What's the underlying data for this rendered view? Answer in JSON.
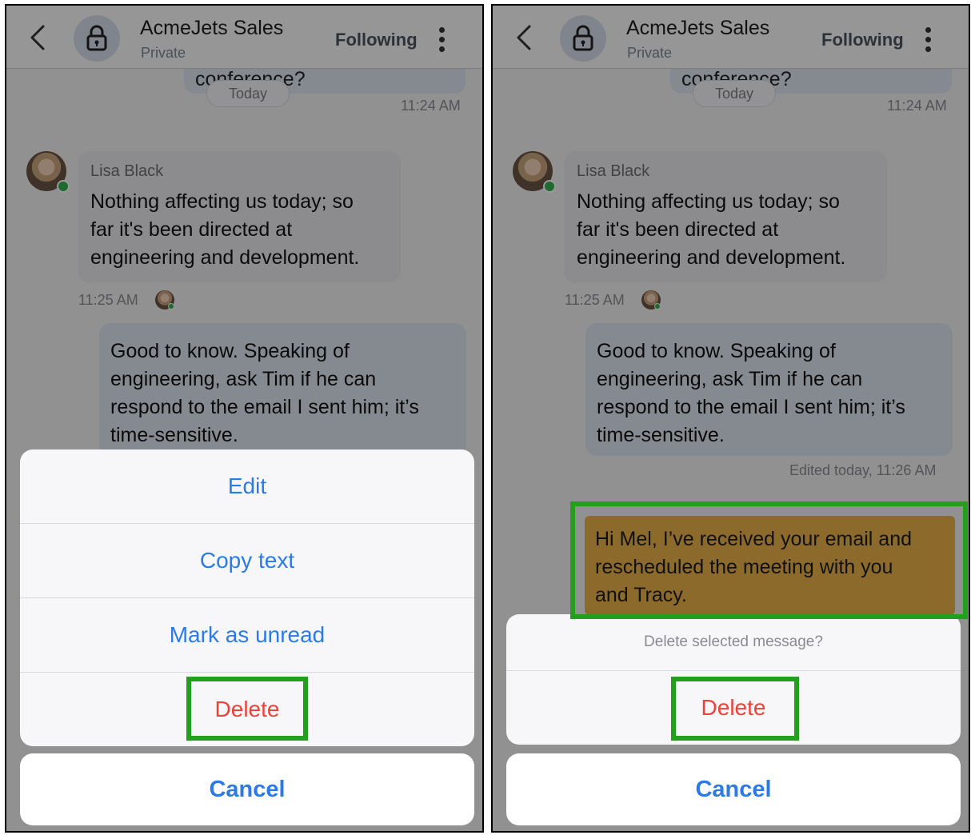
{
  "channel": {
    "title": "AcmeJets Sales",
    "subtitle": "Private",
    "following_label": "Following"
  },
  "previous_message": {
    "partial_text": "conference?"
  },
  "date_chip": "Today",
  "times": {
    "prev_sent": "11:24 AM",
    "lisa_sent": "11:25 AM",
    "edited": "Edited today, 11:26 AM"
  },
  "messages": {
    "lisa": {
      "sender": "Lisa Black",
      "lines": [
        "Nothing affecting us today; so",
        "far it's been directed at",
        "engineering and development."
      ]
    },
    "own": {
      "lines": [
        "Good to know. Speaking of",
        "engineering, ask Tim if he can",
        "respond to the email I sent him; it’s",
        "time-sensitive."
      ]
    },
    "selected": {
      "lines": [
        "Hi Mel, I’ve received your email and",
        "rescheduled the meeting with you",
        "and Tracy."
      ]
    }
  },
  "action_sheet_left": {
    "items": [
      "Edit",
      "Copy text",
      "Mark as unread",
      "Delete"
    ],
    "cancel": "Cancel"
  },
  "action_sheet_right": {
    "prompt": "Delete selected message?",
    "delete": "Delete",
    "cancel": "Cancel"
  },
  "colors": {
    "accent_blue": "#2c7be5",
    "delete_red": "#e8443a",
    "highlight_green": "#22a01c",
    "selected_message_bg": "#8b6a2b"
  },
  "icons": [
    "back-chevron-icon",
    "lock-icon",
    "kebab-menu-icon",
    "online-status-dot"
  ]
}
